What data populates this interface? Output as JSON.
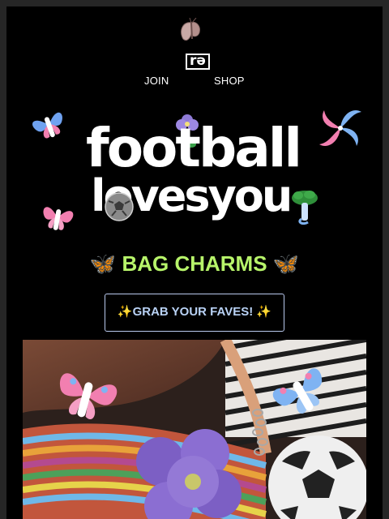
{
  "brand": {
    "logo_text": "rə"
  },
  "nav": {
    "join": "JOIN",
    "shop": "SHOP"
  },
  "hero": {
    "line1": "football",
    "line2": "lovesyou"
  },
  "section": {
    "heading": "🦋 BAG CHARMS 🦋"
  },
  "cta": {
    "label": "✨GRAB YOUR FAVES! ✨"
  },
  "colors": {
    "background": "#000000",
    "heading": "#b7f46a",
    "button_border": "#b9c9ee",
    "butterfly_blue": "#7fb3f2",
    "butterfly_pink": "#f27fb0"
  },
  "icons": [
    "butterfly-icon",
    "moth-icon",
    "flower-icon",
    "mushroom-icon",
    "soccer-ball-icon",
    "sparkle-icon"
  ]
}
